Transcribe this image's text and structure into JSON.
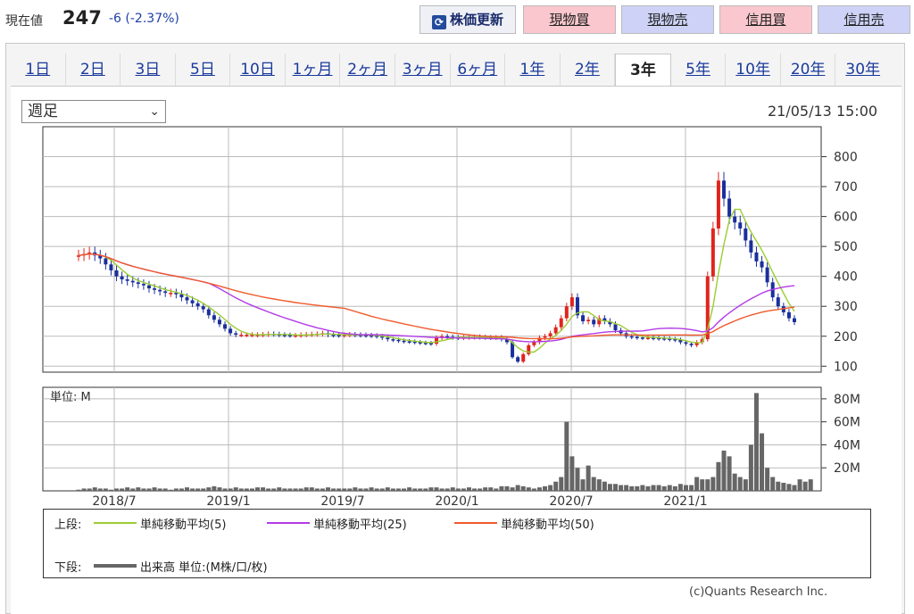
{
  "header": {
    "price_label": "現在値",
    "price_value": "247",
    "price_change": "-6 (-2.37%)",
    "refresh_label": "株価更新",
    "buttons": [
      {
        "label": "現物買",
        "kind": "buy"
      },
      {
        "label": "現物売",
        "kind": "sell"
      },
      {
        "label": "信用買",
        "kind": "buy"
      },
      {
        "label": "信用売",
        "kind": "sell"
      }
    ]
  },
  "tabs": [
    {
      "label": "1日"
    },
    {
      "label": "2日"
    },
    {
      "label": "3日"
    },
    {
      "label": "5日"
    },
    {
      "label": "10日"
    },
    {
      "label": "1ヶ月"
    },
    {
      "label": "2ヶ月"
    },
    {
      "label": "3ヶ月"
    },
    {
      "label": "6ヶ月"
    },
    {
      "label": "1年"
    },
    {
      "label": "2年"
    },
    {
      "label": "3年",
      "active": true
    },
    {
      "label": "5年"
    },
    {
      "label": "10年"
    },
    {
      "label": "20年"
    },
    {
      "label": "30年"
    }
  ],
  "period_select": {
    "value": "週足"
  },
  "datetime": "21/05/13 15:00",
  "colors": {
    "up": "#e0241c",
    "down": "#1a2f9c",
    "ma5": "#9acd32",
    "ma25": "#b23ae8",
    "ma50": "#ef5a2b",
    "volume": "#666666",
    "grid": "#bbbbbb"
  },
  "chart_data": {
    "type": "candlestick",
    "price_axis": {
      "ylim": [
        80,
        900
      ],
      "ticks": [
        100,
        200,
        300,
        400,
        500,
        600,
        700,
        800
      ]
    },
    "volume_axis": {
      "unit_label": "単位: M",
      "ylim": [
        0,
        90
      ],
      "ticks": [
        20,
        40,
        60,
        80
      ],
      "tick_labels": [
        "20M",
        "40M",
        "60M",
        "80M"
      ]
    },
    "x_axis": {
      "ticks": [
        "2018/7",
        "2019/1",
        "2019/7",
        "2020/1",
        "2020/7",
        "2021/1"
      ]
    },
    "close": [
      470,
      475,
      480,
      470,
      460,
      440,
      420,
      400,
      390,
      385,
      380,
      375,
      370,
      360,
      355,
      350,
      345,
      345,
      340,
      330,
      320,
      310,
      300,
      290,
      270,
      255,
      240,
      225,
      210,
      205,
      205,
      205,
      205,
      205,
      206,
      208,
      207,
      205,
      204,
      203,
      203,
      205,
      206,
      207,
      208,
      210,
      205,
      204,
      203,
      205,
      206,
      205,
      204,
      203,
      202,
      200,
      195,
      190,
      188,
      185,
      183,
      182,
      180,
      178,
      177,
      175,
      195,
      200,
      198,
      196,
      195,
      196,
      197,
      198,
      197,
      196,
      195,
      196,
      190,
      180,
      130,
      115,
      140,
      170,
      180,
      195,
      200,
      210,
      230,
      260,
      300,
      330,
      270,
      250,
      255,
      240,
      260,
      250,
      240,
      220,
      210,
      200,
      198,
      196,
      195,
      195,
      194,
      193,
      192,
      190,
      188,
      180,
      175,
      170,
      180,
      190,
      400,
      560,
      720,
      660,
      600,
      580,
      560,
      520,
      480,
      450,
      430,
      380,
      330,
      300,
      280,
      260,
      247
    ],
    "volume": [
      1,
      2,
      2,
      3,
      2,
      2,
      1,
      2,
      2,
      3,
      2,
      3,
      2,
      2,
      3,
      2,
      2,
      1,
      2,
      2,
      3,
      2,
      2,
      2,
      3,
      4,
      3,
      2,
      2,
      3,
      2,
      2,
      2,
      3,
      3,
      2,
      2,
      3,
      2,
      2,
      2,
      2,
      3,
      3,
      2,
      2,
      3,
      2,
      2,
      2,
      2,
      3,
      2,
      2,
      3,
      2,
      2,
      3,
      2,
      2,
      2,
      3,
      2,
      2,
      2,
      3,
      3,
      2,
      2,
      3,
      2,
      2,
      3,
      2,
      2,
      3,
      3,
      2,
      4,
      4,
      3,
      5,
      4,
      3,
      2,
      3,
      4,
      5,
      8,
      12,
      60,
      30,
      20,
      10,
      22,
      12,
      10,
      8,
      6,
      6,
      5,
      5,
      4,
      4,
      5,
      4,
      5,
      5,
      4,
      5,
      4,
      6,
      5,
      5,
      12,
      10,
      10,
      12,
      25,
      35,
      30,
      15,
      12,
      10,
      40,
      85,
      50,
      20,
      12,
      8,
      7,
      6,
      5,
      10,
      8,
      10
    ],
    "series": [
      {
        "name": "単純移動平均(5)"
      },
      {
        "name": "単純移動平均(25)"
      },
      {
        "name": "単純移動平均(50)"
      }
    ]
  },
  "legend": {
    "upper_label": "上段:",
    "lower_label": "下段:",
    "ma5": "単純移動平均(5)",
    "ma25": "単純移動平均(25)",
    "ma50": "単純移動平均(50)",
    "volume": "出来高 単位:(M株/口/枚)"
  },
  "copyright": "(c)Quants Research Inc."
}
